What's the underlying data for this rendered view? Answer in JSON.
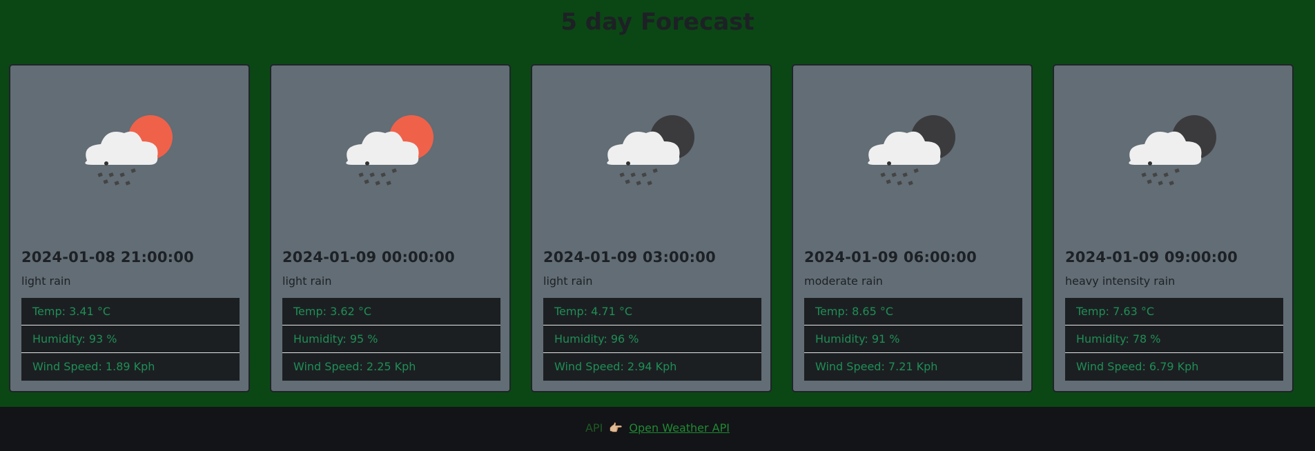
{
  "header": {
    "title": "5 day Forecast"
  },
  "cards": [
    {
      "datetime": "2024-01-08 21:00:00",
      "description": "light rain",
      "temp": "Temp: 3.41 °C",
      "humidity": "Humidity: 93 %",
      "wind": "Wind Speed: 1.89 Kph",
      "icon": "rain-day-icon",
      "celestial_color": "#f0614a"
    },
    {
      "datetime": "2024-01-09 00:00:00",
      "description": "light rain",
      "temp": "Temp: 3.62 °C",
      "humidity": "Humidity: 95 %",
      "wind": "Wind Speed: 2.25 Kph",
      "icon": "rain-day-icon",
      "celestial_color": "#f0614a"
    },
    {
      "datetime": "2024-01-09 03:00:00",
      "description": "light rain",
      "temp": "Temp: 4.71 °C",
      "humidity": "Humidity: 96 %",
      "wind": "Wind Speed: 2.94 Kph",
      "icon": "rain-night-icon",
      "celestial_color": "#3b3b3d"
    },
    {
      "datetime": "2024-01-09 06:00:00",
      "description": "moderate rain",
      "temp": "Temp: 8.65 °C",
      "humidity": "Humidity: 91 %",
      "wind": "Wind Speed: 7.21 Kph",
      "icon": "rain-night-icon",
      "celestial_color": "#3b3b3d"
    },
    {
      "datetime": "2024-01-09 09:00:00",
      "description": "heavy intensity rain",
      "temp": "Temp: 7.63 °C",
      "humidity": "Humidity: 78 %",
      "wind": "Wind Speed: 6.79 Kph",
      "icon": "rain-night-icon",
      "celestial_color": "#3b3b3d"
    }
  ],
  "footer": {
    "label": "API",
    "pointer": "👉🏼",
    "link_text": "Open Weather API"
  },
  "colors": {
    "background": "#0b4714",
    "card": "#626d75",
    "stat_text": "#1e8f55",
    "footer_bg": "#131417"
  }
}
